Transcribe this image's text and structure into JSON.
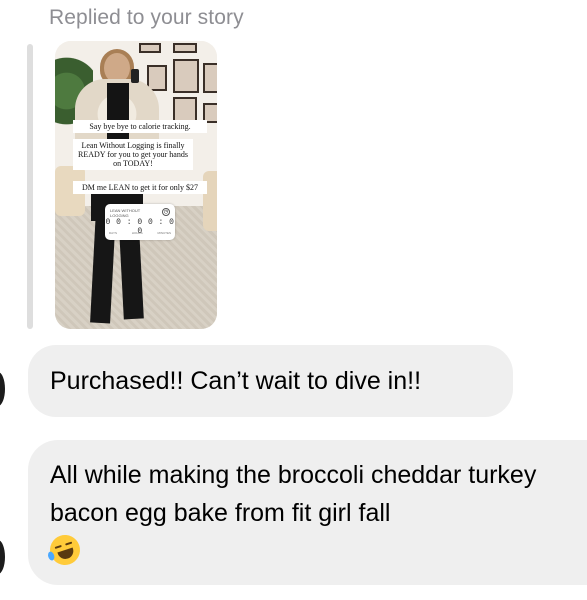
{
  "conversation": {
    "reply_label": "Replied to your story",
    "story": {
      "text_lines": [
        "Say bye bye to calorie tracking.",
        "Lean Without Logging is finally READY for you to get your hands on TODAY!",
        "DM me LEAN to get it for only $27"
      ],
      "countdown": {
        "title": "LEAN WITHOUT LOGGING",
        "digits": "0 0 : 0 0 : 0 0",
        "units": [
          "DAYS",
          "HOURS",
          "MINUTES"
        ],
        "icon": "clock-icon"
      }
    },
    "messages": [
      {
        "text": "Purchased!! Can’t wait to dive in!!"
      },
      {
        "text": "All while making the broccoli cheddar turkey bacon egg bake from fit girl fall",
        "emoji": "rolling-on-floor-laughing-emoji"
      }
    ]
  },
  "colors": {
    "bubble_bg": "#efefef",
    "label_gray": "#8e8e93",
    "reply_bar": "#dedede"
  }
}
